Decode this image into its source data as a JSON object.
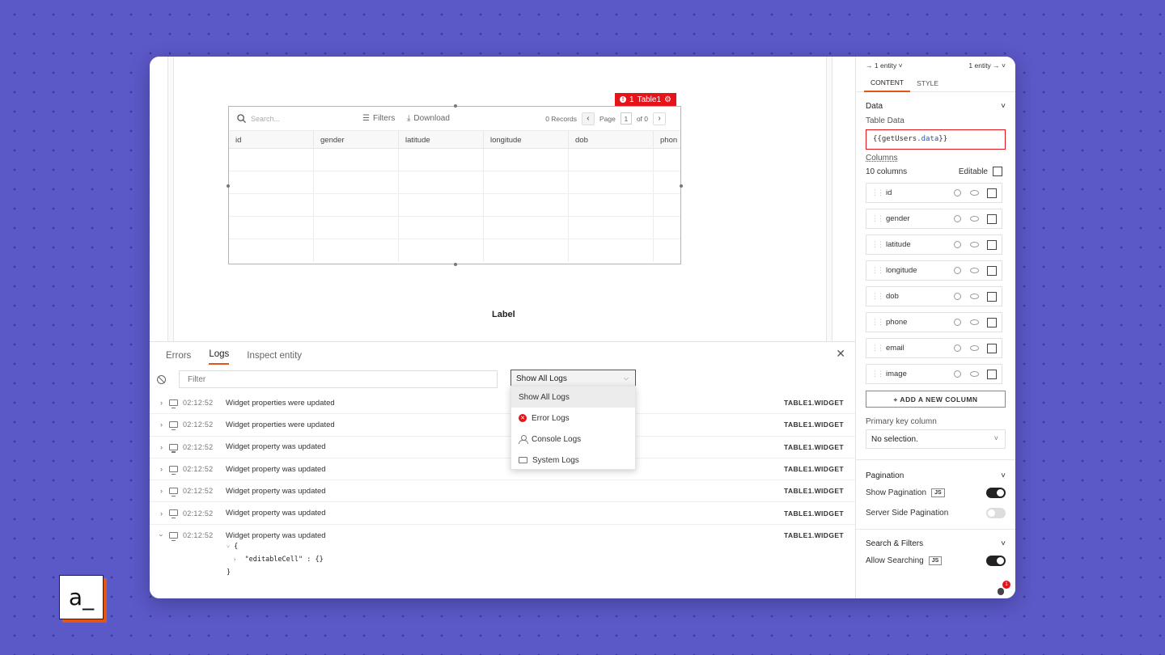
{
  "canvas": {
    "widget_badge": {
      "count": "1",
      "name": "Table1"
    },
    "table": {
      "search_placeholder": "Search...",
      "filters_label": "Filters",
      "download_label": "Download",
      "records": "0 Records",
      "page_label": "Page",
      "page_num": "1",
      "page_of": "of 0",
      "columns": [
        "id",
        "gender",
        "latitude",
        "longitude",
        "dob",
        "phon"
      ]
    },
    "label_widget": "Label"
  },
  "debugger": {
    "tabs": [
      "Errors",
      "Logs",
      "Inspect entity"
    ],
    "active_tab": "Logs",
    "filter_placeholder": "Filter",
    "select_value": "Show All Logs",
    "logs": [
      {
        "time": "02:12:52",
        "message": "Widget properties were updated",
        "source": "TABLE1.WIDGET"
      },
      {
        "time": "02:12:52",
        "message": "Widget properties were updated",
        "source": "TABLE1.WIDGET"
      },
      {
        "time": "02:12:52",
        "message": "Widget property was updated",
        "source": "TABLE1.WIDGET"
      },
      {
        "time": "02:12:52",
        "message": "Widget property was updated",
        "source": "TABLE1.WIDGET"
      },
      {
        "time": "02:12:52",
        "message": "Widget property was updated",
        "source": "TABLE1.WIDGET"
      },
      {
        "time": "02:12:52",
        "message": "Widget property was updated",
        "source": "TABLE1.WIDGET"
      },
      {
        "time": "02:12:52",
        "message": "Widget property was updated",
        "source": "TABLE1.WIDGET"
      }
    ],
    "json_lines": [
      "{",
      "\"editableCell\" : {}",
      "}"
    ],
    "dropdown_options": [
      "Show All Logs",
      "Error Logs",
      "Console Logs",
      "System Logs"
    ]
  },
  "pane": {
    "entity_left": "1 entity",
    "entity_right": "1 entity",
    "tabs": [
      "CONTENT",
      "STYLE"
    ],
    "data_section": "Data",
    "table_data_label": "Table Data",
    "table_data_prefix": "{{",
    "table_data_obj": "getUsers",
    "table_data_prop": ".data",
    "table_data_suffix": "}}",
    "columns_label": "Columns",
    "columns_count": "10 columns",
    "editable_label": "Editable",
    "columns": [
      "id",
      "gender",
      "latitude",
      "longitude",
      "dob",
      "phone",
      "email",
      "image"
    ],
    "add_column": "+ ADD A NEW COLUMN",
    "primary_key_label": "Primary key column",
    "primary_key_value": "No selection.",
    "pagination_section": "Pagination",
    "show_pagination": "Show Pagination",
    "server_side_pagination": "Server Side Pagination",
    "search_section": "Search & Filters",
    "allow_searching": "Allow Searching",
    "js_badge": "JS",
    "debug_count": "1"
  },
  "logo_text": "a_"
}
